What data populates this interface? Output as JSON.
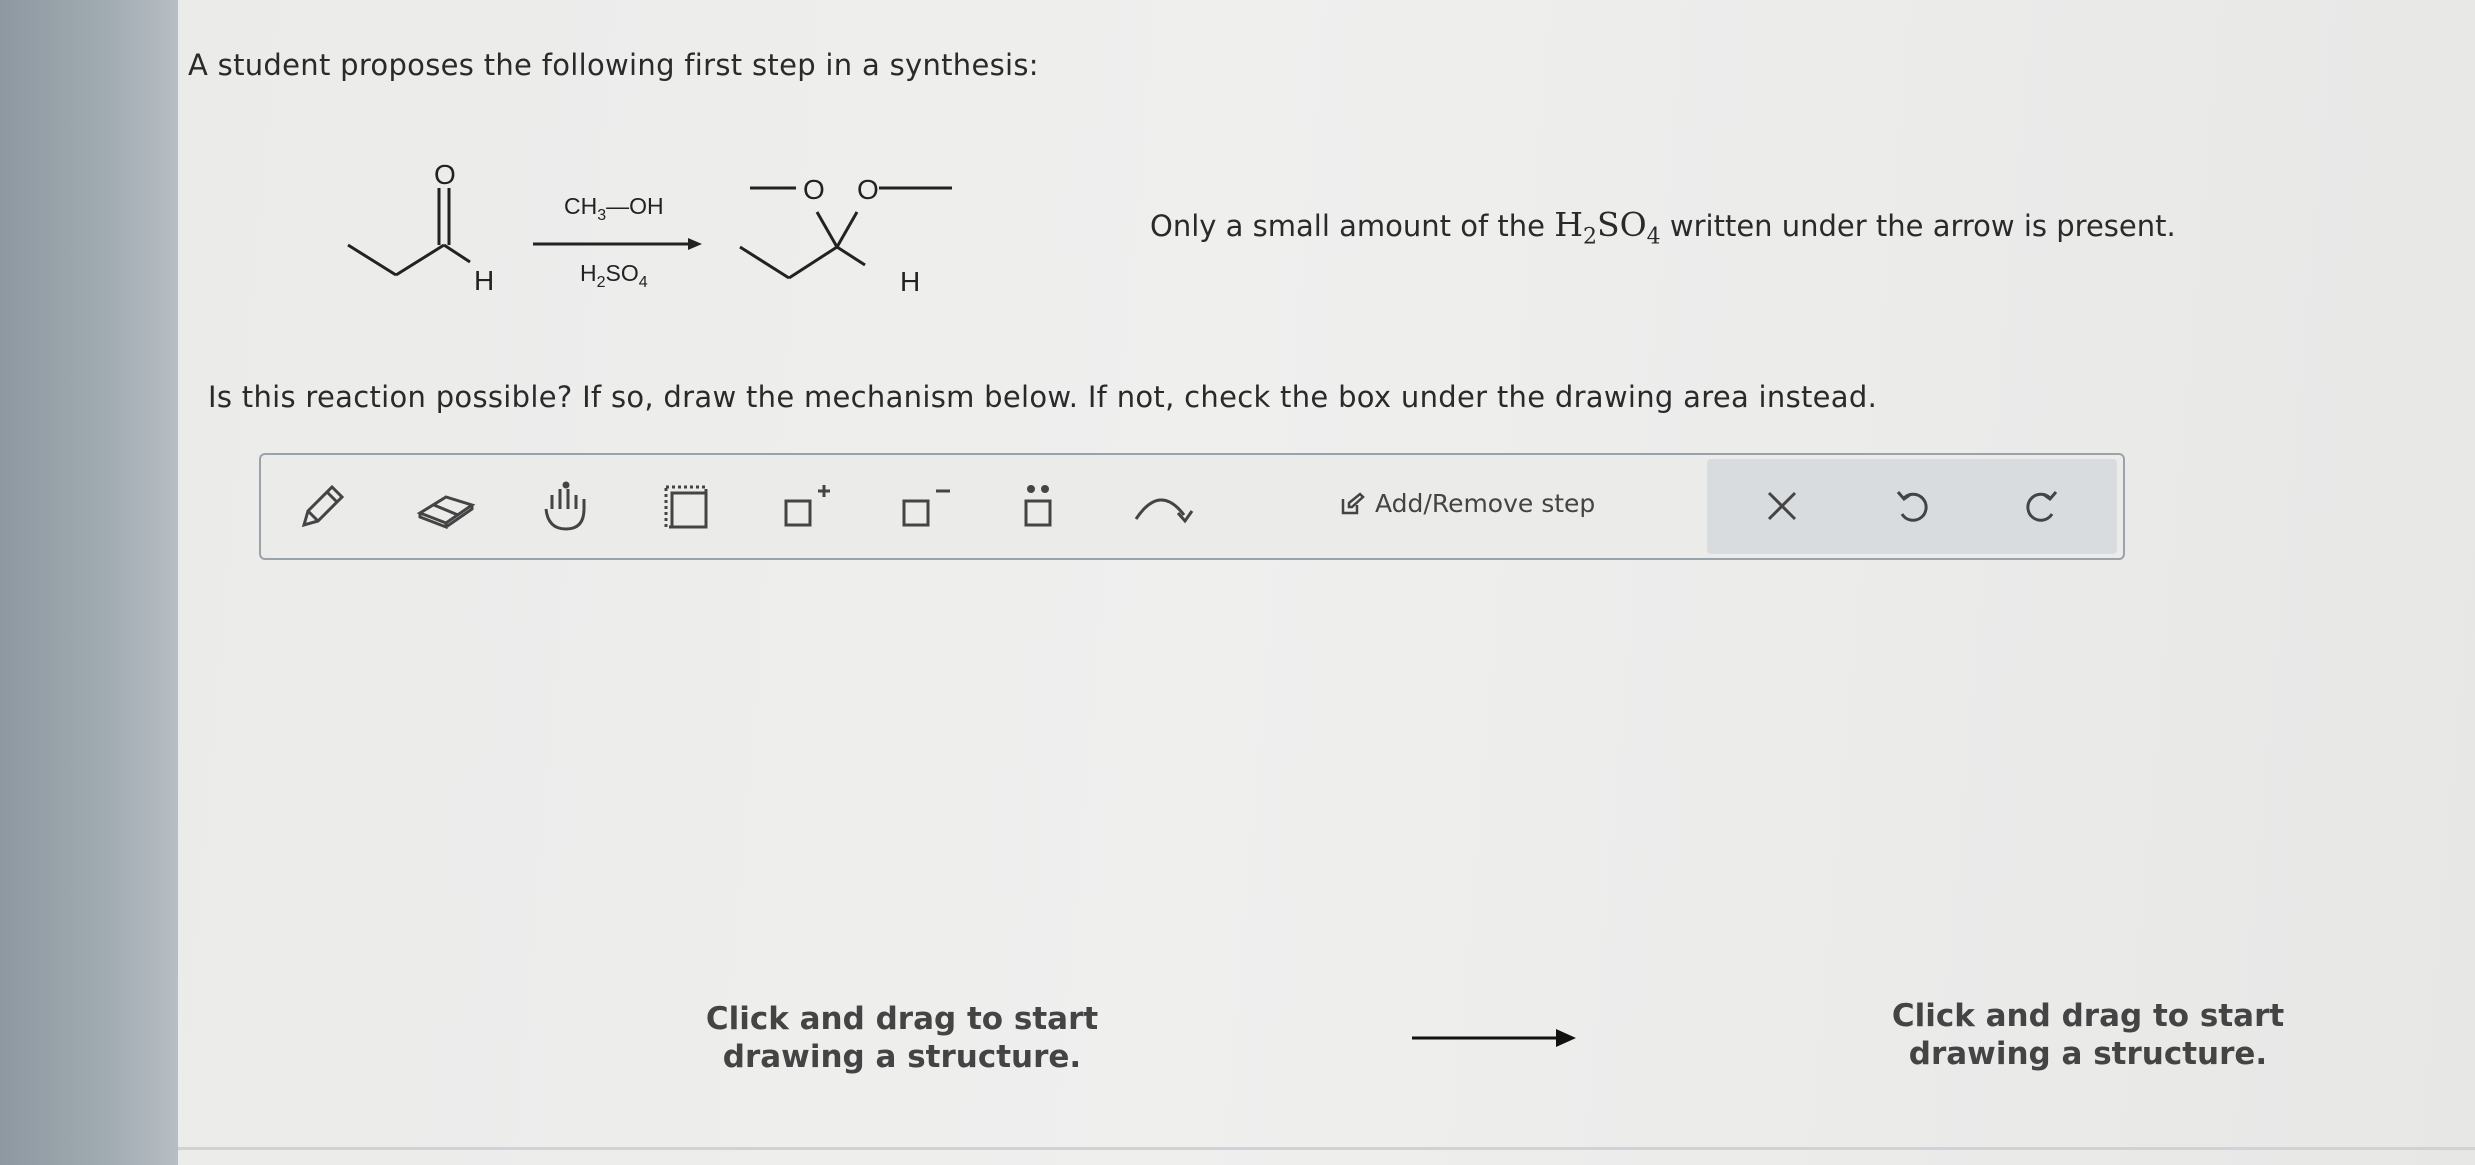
{
  "question": {
    "intro": "A student proposes the following first step in a synthesis:",
    "instruction": "Is this reaction possible? If so, draw the mechanism below. If not, check the box under the drawing area instead.",
    "note_before": "Only a small amount of the",
    "note_formula_main": "H",
    "note_formula_sub1": "2",
    "note_formula_mid": "SO",
    "note_formula_sub2": "4",
    "note_after": "written under the arrow is present."
  },
  "reaction": {
    "reactant_atoms": {
      "oxygen": "O",
      "hydrogen": "H"
    },
    "reagent_above": {
      "ch": "CH",
      "sub": "3",
      "tail": "—OH"
    },
    "reagent_below": {
      "h": "H",
      "sub1": "2",
      "so": "SO",
      "sub2": "4"
    },
    "product_atoms": {
      "oxygen_left": "O",
      "oxygen_right": "O",
      "hydrogen": "H"
    }
  },
  "toolbar": {
    "tools": [
      "pencil-icon",
      "eraser-icon",
      "hand-icon",
      "selection-icon",
      "positive-charge-icon",
      "negative-charge-icon",
      "lone-pair-icon",
      "curved-arrow-icon"
    ],
    "add_remove_label": "Add/Remove step",
    "clear_icon": "close-icon",
    "undo_icon": "undo-icon",
    "redo_icon": "redo-icon"
  },
  "drawing_area": {
    "left_hint": "Click and drag to start drawing a structure.",
    "right_hint": "Click and drag to start drawing a structure."
  }
}
